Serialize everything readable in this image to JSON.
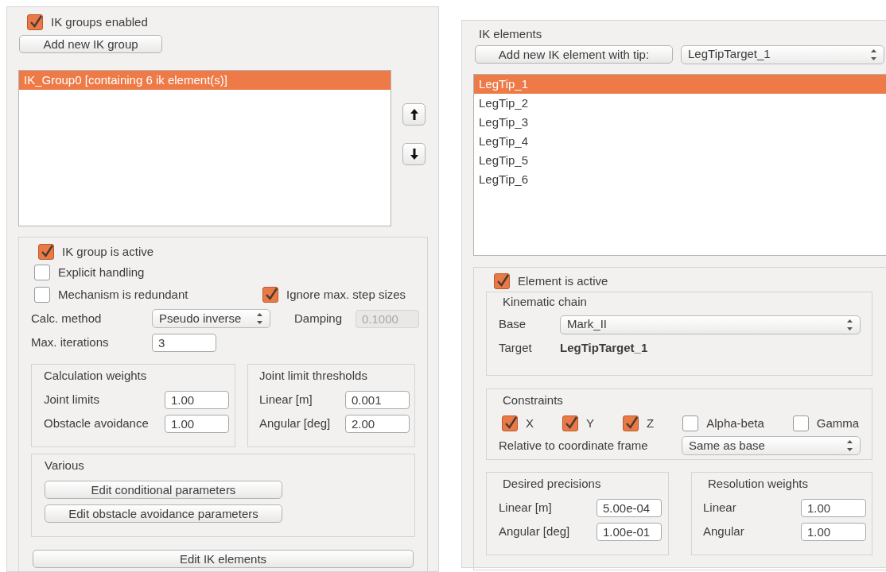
{
  "ik_groups": {
    "groups_enabled": {
      "label": "IK groups enabled",
      "checked": true
    },
    "add_button": "Add new IK group",
    "groups": [
      {
        "label": "IK_Group0 [containing 6 ik element(s)]",
        "selected": true
      }
    ],
    "group_settings": {
      "active": {
        "label": "IK group is active",
        "checked": true
      },
      "explicit_handling": {
        "label": "Explicit handling",
        "checked": false
      },
      "redundant": {
        "label": "Mechanism is redundant",
        "checked": false
      },
      "ignore_step_sizes": {
        "label": "Ignore max. step sizes",
        "checked": true
      },
      "calc_method": {
        "label": "Calc. method",
        "value": "Pseudo inverse"
      },
      "damping": {
        "label": "Damping",
        "value": "0.1000",
        "disabled": true
      },
      "max_iterations": {
        "label": "Max. iterations",
        "value": "3"
      },
      "calculation_weights": {
        "title": "Calculation weights",
        "fields": [
          {
            "label": "Joint limits",
            "value": "1.00"
          },
          {
            "label": "Obstacle avoidance",
            "value": "1.00"
          }
        ]
      },
      "joint_limit_thresholds": {
        "title": "Joint limit thresholds",
        "fields": [
          {
            "label": "Linear [m]",
            "value": "0.001"
          },
          {
            "label": "Angular [deg]",
            "value": "2.00"
          }
        ]
      },
      "various": {
        "title": "Various",
        "buttons": [
          "Edit conditional parameters",
          "Edit obstacle avoidance parameters"
        ]
      },
      "edit_button": "Edit IK elements"
    }
  },
  "ik_elements": {
    "title": "IK elements",
    "add_button": "Add new IK element with tip:",
    "tip_combo": "LegTipTarget_1",
    "elements": [
      {
        "label": "LegTip_1",
        "selected": true
      },
      {
        "label": "LegTip_2",
        "selected": false
      },
      {
        "label": "LegTip_3",
        "selected": false
      },
      {
        "label": "LegTip_4",
        "selected": false
      },
      {
        "label": "LegTip_5",
        "selected": false
      },
      {
        "label": "LegTip_6",
        "selected": false
      }
    ],
    "element_active": {
      "label": "Element is active",
      "checked": true
    },
    "kinematic_chain": {
      "title": "Kinematic chain",
      "base": {
        "label": "Base",
        "value": "Mark_II"
      },
      "target": {
        "label": "Target",
        "value": "LegTipTarget_1"
      }
    },
    "constraints": {
      "title": "Constraints",
      "items": [
        {
          "label": "X",
          "checked": true
        },
        {
          "label": "Y",
          "checked": true
        },
        {
          "label": "Z",
          "checked": true
        },
        {
          "label": "Alpha-beta",
          "checked": false
        },
        {
          "label": "Gamma",
          "checked": false
        }
      ],
      "relative": {
        "label": "Relative to coordinate frame",
        "value": "Same as base"
      }
    },
    "desired_precisions": {
      "title": "Desired precisions",
      "fields": [
        {
          "label": "Linear [m]",
          "value": "5.00e-04"
        },
        {
          "label": "Angular [deg]",
          "value": "1.00e-01"
        }
      ]
    },
    "resolution_weights": {
      "title": "Resolution weights",
      "fields": [
        {
          "label": "Linear",
          "value": "1.00"
        },
        {
          "label": "Angular",
          "value": "1.00"
        }
      ]
    }
  }
}
